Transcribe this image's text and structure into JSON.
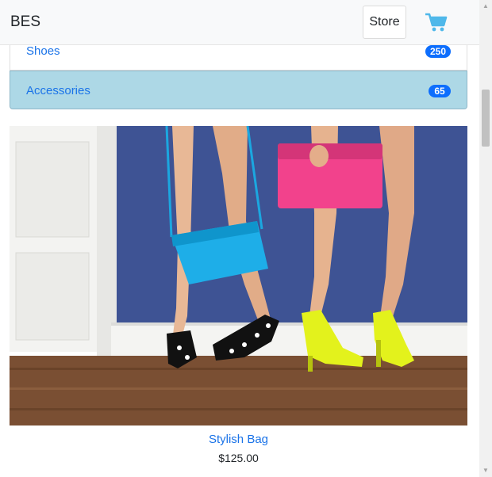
{
  "navbar": {
    "brand": "BES",
    "store_label": "Store",
    "cart_icon": "shopping-cart-icon",
    "cart_color": "#4fb8ea"
  },
  "categories": [
    {
      "label": "Shoes",
      "count": "250"
    },
    {
      "label": "Accessories",
      "count": "65"
    }
  ],
  "product": {
    "name": "Stylish Bag",
    "price": "$125.00",
    "image_icon": "product-photo"
  },
  "colors": {
    "link": "#1a73e8",
    "active_bg": "#add8e6",
    "badge": "#0d6efd"
  }
}
